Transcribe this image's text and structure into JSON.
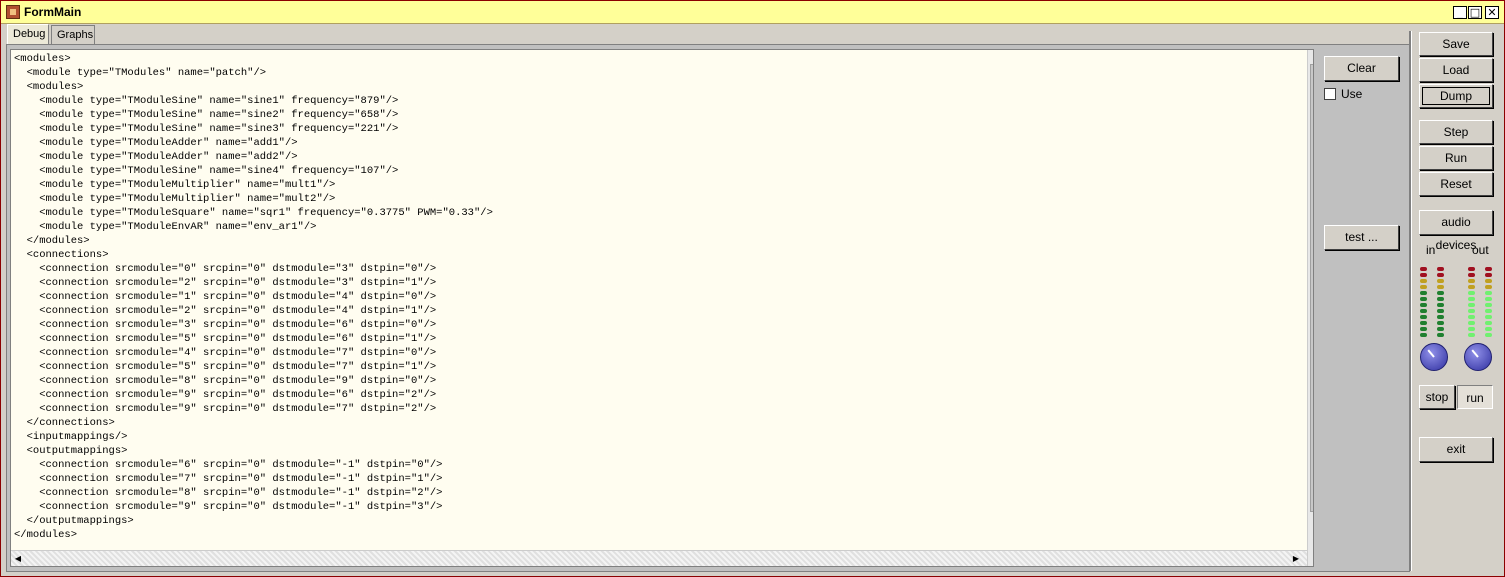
{
  "window": {
    "title": "FormMain"
  },
  "titlebar_buttons": {
    "minimize": "_",
    "maximize": "□",
    "close": "✕"
  },
  "tabs": [
    {
      "label": "Debug",
      "active": true
    },
    {
      "label": "Graphs",
      "active": false
    }
  ],
  "editor": {
    "text": "<modules>\n  <module type=\"TModules\" name=\"patch\"/>\n  <modules>\n    <module type=\"TModuleSine\" name=\"sine1\" frequency=\"879\"/>\n    <module type=\"TModuleSine\" name=\"sine2\" frequency=\"658\"/>\n    <module type=\"TModuleSine\" name=\"sine3\" frequency=\"221\"/>\n    <module type=\"TModuleAdder\" name=\"add1\"/>\n    <module type=\"TModuleAdder\" name=\"add2\"/>\n    <module type=\"TModuleSine\" name=\"sine4\" frequency=\"107\"/>\n    <module type=\"TModuleMultiplier\" name=\"mult1\"/>\n    <module type=\"TModuleMultiplier\" name=\"mult2\"/>\n    <module type=\"TModuleSquare\" name=\"sqr1\" frequency=\"0.3775\" PWM=\"0.33\"/>\n    <module type=\"TModuleEnvAR\" name=\"env_ar1\"/>\n  </modules>\n  <connections>\n    <connection srcmodule=\"0\" srcpin=\"0\" dstmodule=\"3\" dstpin=\"0\"/>\n    <connection srcmodule=\"2\" srcpin=\"0\" dstmodule=\"3\" dstpin=\"1\"/>\n    <connection srcmodule=\"1\" srcpin=\"0\" dstmodule=\"4\" dstpin=\"0\"/>\n    <connection srcmodule=\"2\" srcpin=\"0\" dstmodule=\"4\" dstpin=\"1\"/>\n    <connection srcmodule=\"3\" srcpin=\"0\" dstmodule=\"6\" dstpin=\"0\"/>\n    <connection srcmodule=\"5\" srcpin=\"0\" dstmodule=\"6\" dstpin=\"1\"/>\n    <connection srcmodule=\"4\" srcpin=\"0\" dstmodule=\"7\" dstpin=\"0\"/>\n    <connection srcmodule=\"5\" srcpin=\"0\" dstmodule=\"7\" dstpin=\"1\"/>\n    <connection srcmodule=\"8\" srcpin=\"0\" dstmodule=\"9\" dstpin=\"0\"/>\n    <connection srcmodule=\"9\" srcpin=\"0\" dstmodule=\"6\" dstpin=\"2\"/>\n    <connection srcmodule=\"9\" srcpin=\"0\" dstmodule=\"7\" dstpin=\"2\"/>\n  </connections>\n  <inputmappings/>\n  <outputmappings>\n    <connection srcmodule=\"6\" srcpin=\"0\" dstmodule=\"-1\" dstpin=\"0\"/>\n    <connection srcmodule=\"7\" srcpin=\"0\" dstmodule=\"-1\" dstpin=\"1\"/>\n    <connection srcmodule=\"8\" srcpin=\"0\" dstmodule=\"-1\" dstpin=\"2\"/>\n    <connection srcmodule=\"9\" srcpin=\"0\" dstmodule=\"-1\" dstpin=\"3\"/>\n  </outputmappings>\n</modules>"
  },
  "side_panel": {
    "clear": "Clear",
    "use": "Use",
    "use_checked": false,
    "test": "test ..."
  },
  "right_panel": {
    "save": "Save",
    "load": "Load",
    "dump": "Dump",
    "step": "Step",
    "run": "Run",
    "reset": "Reset",
    "audio_devices": "audio devices",
    "in_label": "in",
    "out_label": "out",
    "stop": "stop",
    "run_toggle": "run",
    "exit": "exit"
  },
  "colors": {
    "titlebar": "#ffff99",
    "editor_bg": "#fffdf0",
    "led_red": "#a01020",
    "led_amber": "#c0a020",
    "led_green_off": "#208030",
    "led_green_on": "#70f070"
  }
}
